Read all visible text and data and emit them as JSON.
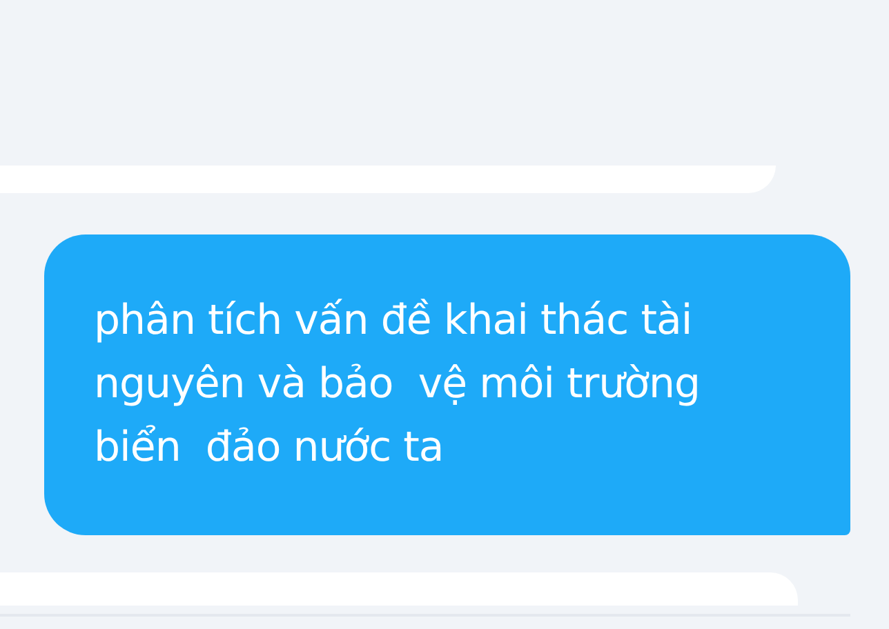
{
  "messages": [
    {
      "kind": "sent",
      "text": "phân tích vấn đề khai thác tài nguyên và bảo  vệ môi trường biển  đảo nước ta"
    }
  ]
}
